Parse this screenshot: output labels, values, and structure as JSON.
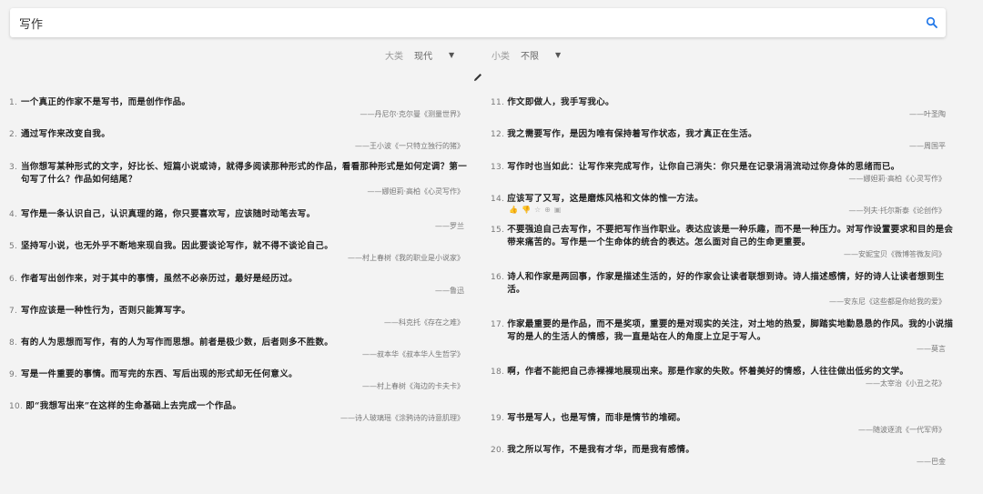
{
  "search": {
    "value": "写作"
  },
  "filters": {
    "major": {
      "label": "大类",
      "value": "现代"
    },
    "minor": {
      "label": "小类",
      "value": "不限"
    }
  },
  "left": [
    {
      "num": "1.",
      "text": "一个真正的作家不是写书，而是创作作品。",
      "source": "——丹尼尔·克尔曼《测量世界》"
    },
    {
      "num": "2.",
      "text": "通过写作来改变自我。",
      "source": "——王小波《一只特立独行的猪》"
    },
    {
      "num": "3.",
      "text": "当你想写某种形式的文字，好比长、短篇小说或诗，就得多阅读那种形式的作品，看看那种形式是如何定调？第一句写了什么？作品如何结尾？",
      "source": "——娜妲莉·高柏《心灵写作》"
    },
    {
      "num": "4.",
      "text": "写作是一条认识自己，认识真理的路，你只要喜欢写，应该随时动笔去写。",
      "source": "——罗兰"
    },
    {
      "num": "5.",
      "text": "坚持写小说，也无外乎不断地来现自我。因此要谈论写作，就不得不谈论自己。",
      "source": "——村上春树《我的职业是小说家》"
    },
    {
      "num": "6.",
      "text": "作者写出创作来，对于其中的事情，虽然不必亲历过，最好是经历过。",
      "source": "——鲁迅"
    },
    {
      "num": "7.",
      "text": "写作应该是一种性行为，否则只能算写字。",
      "source": "——科克托《存在之难》"
    },
    {
      "num": "8.",
      "text": "有的人为思想而写作，有的人为写作而思想。前者是极少数，后者则多不胜数。",
      "source": "——叔本华《叔本华人生哲学》"
    },
    {
      "num": "9.",
      "text": "写是一件重要的事情。而写完的东西、写后出现的形式却无任何意义。",
      "source": "——村上春树《海边的卡夫卡》"
    },
    {
      "num": "10.",
      "text": "即“我想写出来”在这样的生命基础上去完成一个作品。",
      "source": "——诗人玻璃瑶《涂鸦诗的诗意肌理》"
    }
  ],
  "right": [
    {
      "num": "11.",
      "text": "作文即做人，我手写我心。",
      "source": "——叶圣陶"
    },
    {
      "num": "12.",
      "text": "我之需要写作，是因为唯有保持着写作状态，我才真正在生活。",
      "source": "——周国平"
    },
    {
      "num": "13.",
      "text": "写作时也当如此：让写作来完成写作，让你自己消失：你只是在记录涓涓流动过你身体的思绪而已。",
      "source": "——娜妲莉·高柏《心灵写作》"
    },
    {
      "num": "14.",
      "text": "应该写了又写，这是磨炼风格和文体的惟一方法。",
      "source": "——列夫·托尔斯泰《论创作》",
      "icons": [
        "👍",
        "👎",
        "☆",
        "⊕",
        "▣"
      ]
    },
    {
      "num": "15.",
      "text": "不要强迫自己去写作，不要把写作当作职业。表达应该是一种乐趣，而不是一种压力。对写作设置要求和目的是会带来痛苦的。写作是一个生命体的统合的表达。怎么面对自己的生命更重要。",
      "source": "——安妮宝贝《微博答微友问》"
    },
    {
      "num": "16.",
      "text": "诗人和作家是两回事，作家是描述生活的，好的作家会让读者联想到诗。诗人描述感情，好的诗人让读者想到生活。",
      "source": "——安东尼《这些都是你给我的爱》"
    },
    {
      "num": "17.",
      "text": "作家最重要的是作品，而不是奖项，重要的是对现实的关注，对土地的热爱，脚踏实地勤恳恳的作风。我的小说描写的是人的生活人的情感，我一直是站在人的角度上立足于写人。",
      "source": "——莫言"
    },
    {
      "num": "18.",
      "text": "啊，作者不能把自己赤裸裸地展现出来。那是作家的失败。怀着美好的情感，人往往做出低劣的文学。",
      "source": "——太宰治《小丑之花》"
    },
    {
      "num": "19.",
      "text": "写书是写人，也是写情，而非是情节的堆砌。",
      "source": "——随波逐流《一代军师》"
    },
    {
      "num": "20.",
      "text": "我之所以写作，不是我有才华，而是我有感情。",
      "source": "——巴金"
    }
  ]
}
